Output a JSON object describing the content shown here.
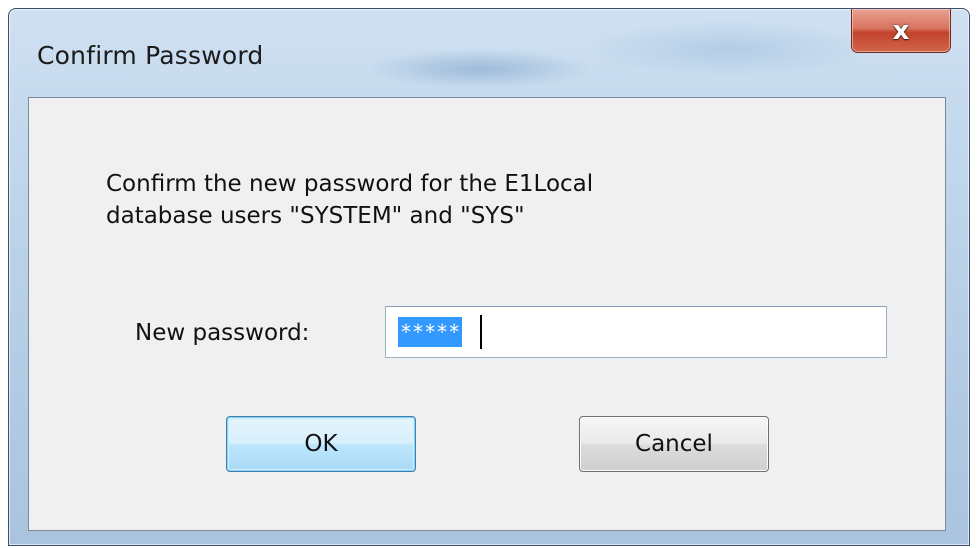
{
  "window": {
    "title": "Confirm Password",
    "close_glyph": "x"
  },
  "dialog": {
    "message_line1": "Confirm the new password for the E1Local",
    "message_line2": "database users \"SYSTEM\" and \"SYS\"",
    "password_label": "New password:",
    "password_value": "*****"
  },
  "buttons": {
    "ok_label": "OK",
    "cancel_label": "Cancel"
  },
  "icons": {
    "close": "close-icon"
  },
  "colors": {
    "selection": "#3399ff",
    "close_button": "#c2432b",
    "default_button_border": "#3c7fb1"
  }
}
